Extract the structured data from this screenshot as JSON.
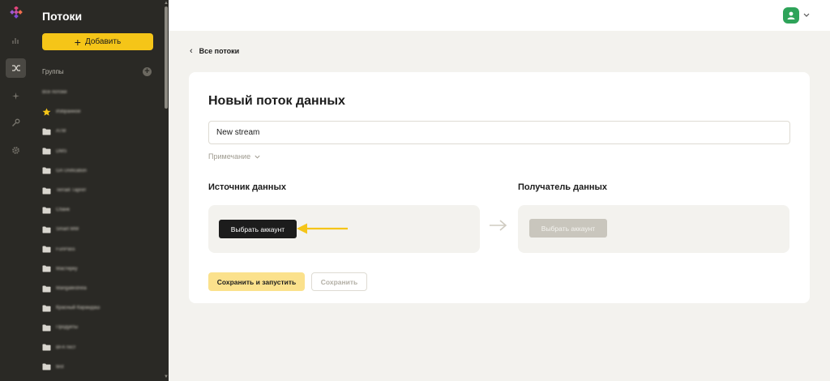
{
  "rail": {
    "icons": [
      "logo-icon",
      "analytics-icon",
      "streams-icon",
      "magic-icon",
      "key-icon",
      "settings-icon"
    ]
  },
  "sidebar": {
    "title": "Потоки",
    "add_label": "Добавить",
    "groups_label": "Группы",
    "groups": [
      {
        "icon": "none",
        "label": "Все потоки"
      },
      {
        "icon": "star",
        "label": "Избранное"
      },
      {
        "icon": "folder",
        "label": "ATM"
      },
      {
        "icon": "folder",
        "label": "DMS"
      },
      {
        "icon": "folder",
        "label": "GA Unification"
      },
      {
        "icon": "folder",
        "label": "Terraill Таргет"
      },
      {
        "icon": "folder",
        "label": "Сбанк"
      },
      {
        "icon": "folder",
        "label": "Smart MW"
      },
      {
        "icon": "folder",
        "label": "FunPass"
      },
      {
        "icon": "folder",
        "label": "Мастерку"
      },
      {
        "icon": "folder",
        "label": "Mangalestrela"
      },
      {
        "icon": "folder",
        "label": "Красный Карандаш"
      },
      {
        "icon": "folder",
        "label": "Продукты"
      },
      {
        "icon": "folder",
        "label": "BFA тест"
      },
      {
        "icon": "folder",
        "label": "test"
      }
    ]
  },
  "header": {
    "avatar_icon": "user-avatar-icon"
  },
  "breadcrumb": {
    "back_label": "Все потоки"
  },
  "form": {
    "title": "Новый поток данных",
    "name_value": "New stream",
    "note_label": "Примечание",
    "source_title": "Источник данных",
    "source_button": "Выбрать аккаунт",
    "target_title": "Получатель данных",
    "target_button": "Выбрать аккаунт",
    "save_run_label": "Сохранить и запустить",
    "save_label": "Сохранить"
  },
  "colors": {
    "sidebar_bg": "#2a2925",
    "accent_yellow": "#f5c518",
    "annotation_arrow": "#f5c518",
    "avatar_green": "#2ea359"
  }
}
